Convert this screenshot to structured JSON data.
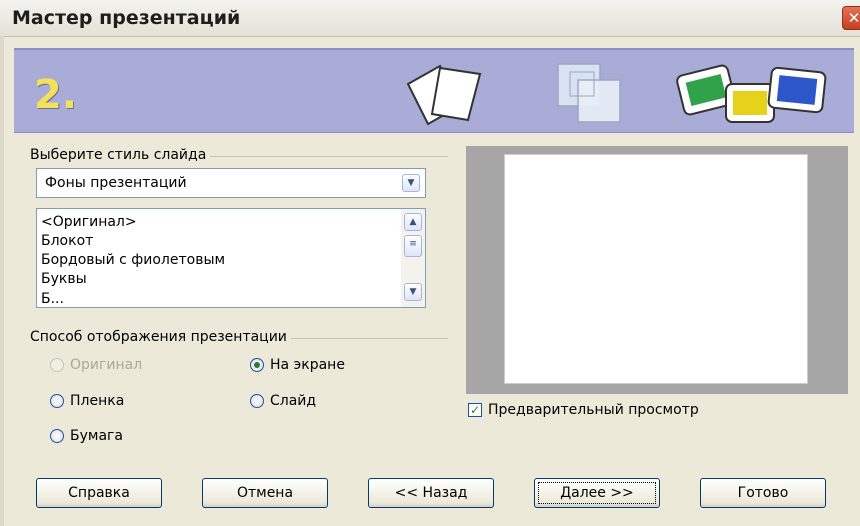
{
  "window": {
    "title": "Мастер презентаций",
    "close_glyph": "✕"
  },
  "banner": {
    "step_number": "2."
  },
  "slide_style": {
    "group_label": "Выберите стиль слайда",
    "category_selected": "Фоны презентаций",
    "items": [
      "<Оригинал>",
      "Блокот",
      "Бордовый с фиолетовым",
      "Буквы",
      "Б..."
    ]
  },
  "output": {
    "group_label": "Способ отображения презентации",
    "options": {
      "original": {
        "label": "Оригинал",
        "disabled": true,
        "selected": false
      },
      "screen": {
        "label": "На экране",
        "disabled": false,
        "selected": true
      },
      "film": {
        "label": "Пленка",
        "disabled": false,
        "selected": false
      },
      "slide": {
        "label": "Слайд",
        "disabled": false,
        "selected": false
      },
      "paper": {
        "label": "Бумага",
        "disabled": false,
        "selected": false
      }
    }
  },
  "preview_checkbox": {
    "label": "Предварительный просмотр",
    "checked": true
  },
  "buttons": {
    "help": "Справка",
    "cancel": "Отмена",
    "back": "<< Назад",
    "next": "Далее >>",
    "finish": "Готово"
  }
}
